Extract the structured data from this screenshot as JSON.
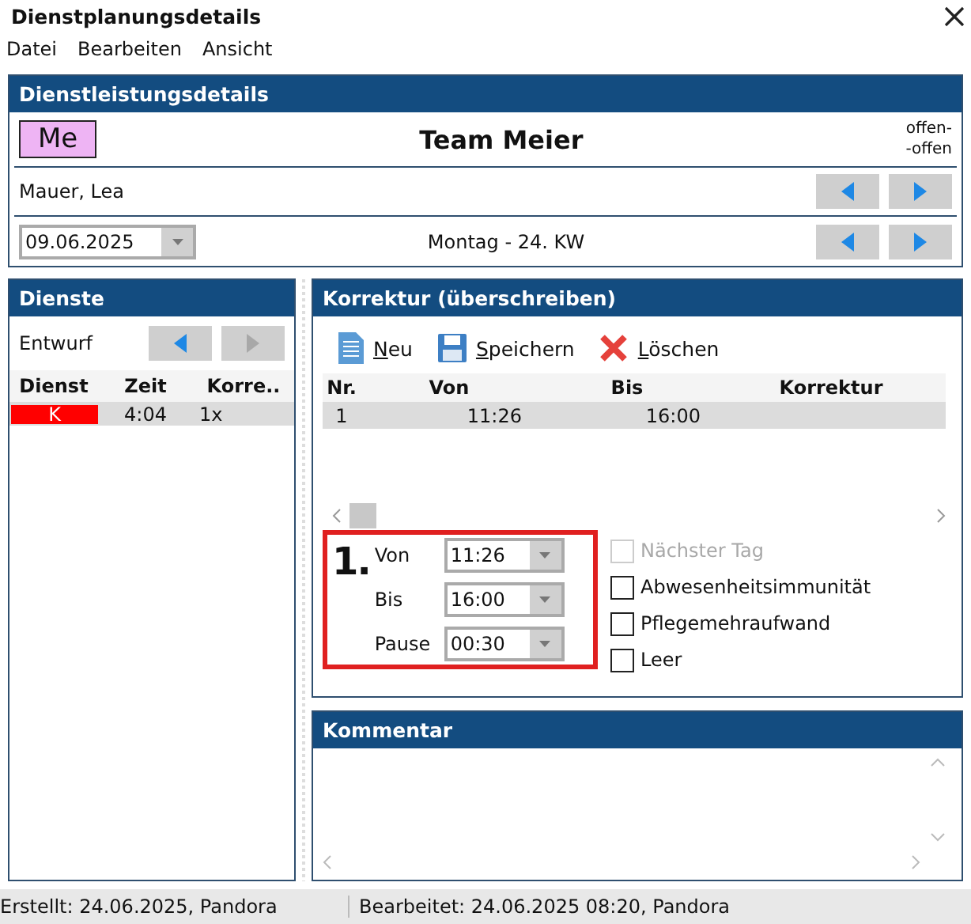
{
  "window": {
    "title": "Dienstplanungsdetails"
  },
  "menu": [
    "Datei",
    "Bearbeiten",
    "Ansicht"
  ],
  "details": {
    "title": "Dienstleistungsdetails",
    "badge": {
      "text": "Me",
      "color": "#eeb4f4"
    },
    "team": "Team Meier",
    "range": [
      "offen-",
      "-offen"
    ],
    "person": "Mauer, Lea",
    "person_nav": [
      {
        "kind": "prev",
        "disabled": false
      },
      {
        "kind": "next",
        "disabled": false
      }
    ],
    "date": "09.06.2025",
    "day": "Montag - 24. KW",
    "date_nav": [
      {
        "kind": "prev",
        "disabled": false
      },
      {
        "kind": "next",
        "disabled": false
      }
    ]
  },
  "dienste": {
    "title": "Dienste",
    "status": "Entwurf",
    "nav": [
      {
        "kind": "prev",
        "disabled": false
      },
      {
        "kind": "next",
        "disabled": true
      }
    ],
    "columns": [
      "Dienst",
      "Zeit",
      "Korre.."
    ],
    "rows": [
      {
        "dienst": "K",
        "color": "#ff0000",
        "zeit": "4:04",
        "korrektur": "1x",
        "selected": true
      }
    ]
  },
  "korrektur": {
    "title": "Korrektur (überschreiben)",
    "toolbar": [
      {
        "kind": "new",
        "label": "Neu"
      },
      {
        "kind": "save",
        "label": "Speichern"
      },
      {
        "kind": "delete",
        "label": "Löschen"
      }
    ],
    "columns": [
      "Nr.",
      "Von",
      "Bis",
      "Korrektur"
    ],
    "rows": [
      {
        "nr": "1",
        "von": "11:26",
        "bis": "16:00",
        "selected": true
      }
    ],
    "entry": {
      "number": "1.",
      "fields": [
        {
          "label": "Von",
          "value": "11:26"
        },
        {
          "label": "Bis",
          "value": "16:00"
        },
        {
          "label": "Pause",
          "value": "00:30"
        }
      ]
    },
    "options": [
      {
        "label": "Nächster Tag",
        "checked": false,
        "disabled": true
      },
      {
        "label": "Abwesenheitsimmunität",
        "checked": false,
        "disabled": false
      },
      {
        "label": "Pflegemehraufwand",
        "checked": false,
        "disabled": false
      },
      {
        "label": "Leer",
        "checked": false,
        "disabled": false
      }
    ]
  },
  "kommentar": {
    "title": "Kommentar"
  },
  "status_bar": [
    "Erstellt: 24.06.2025, Pandora",
    "Bearbeitet: 24.06.2025 08:20, Pandora"
  ]
}
